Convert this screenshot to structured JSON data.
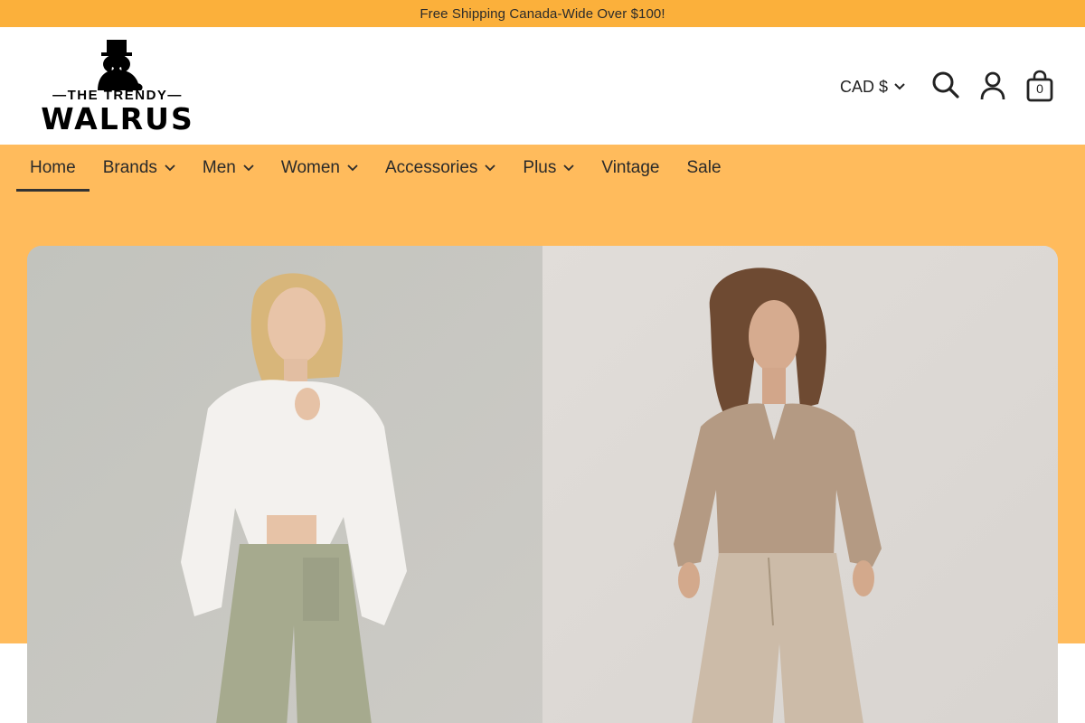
{
  "announcement": {
    "text": "Free Shipping Canada-Wide Over $100!"
  },
  "logo": {
    "top_line": "—THE TRENDY—",
    "main": "WALRUS"
  },
  "header": {
    "currency": "CAD $",
    "search_icon": "search-icon",
    "account_icon": "account-icon",
    "cart_icon": "cart-bag-icon",
    "cart_count": "0"
  },
  "nav": {
    "items": [
      {
        "label": "Home",
        "active": true,
        "dropdown": false
      },
      {
        "label": "Brands",
        "dropdown": true
      },
      {
        "label": "Men",
        "dropdown": true
      },
      {
        "label": "Women",
        "dropdown": true
      },
      {
        "label": "Accessories",
        "dropdown": true
      },
      {
        "label": "Plus",
        "dropdown": true
      },
      {
        "label": "Vintage",
        "dropdown": false
      },
      {
        "label": "Sale",
        "dropdown": false
      }
    ]
  },
  "colors": {
    "announcement_bg": "#fbb03b",
    "nav_bg": "#ffbb5c",
    "text": "#2a2a2a"
  },
  "hero": {
    "left_image": "woman in white button-up shirt and sage wide-leg trousers",
    "right_image": "woman in taupe v-neck sweater and beige wide-leg jeans"
  }
}
